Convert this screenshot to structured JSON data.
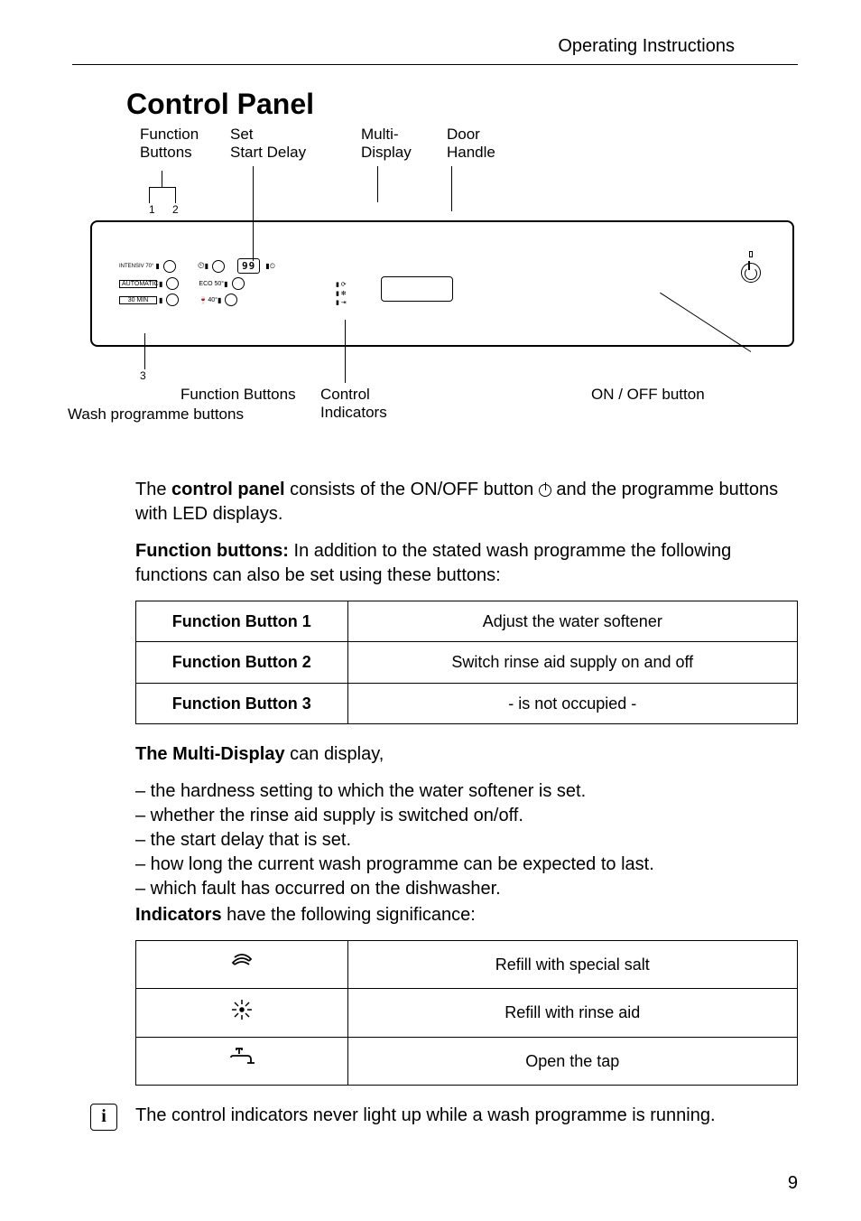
{
  "header": {
    "title": "Operating Instructions"
  },
  "heading": "Control Panel",
  "diagram": {
    "labels": {
      "function_buttons": "Function\nButtons",
      "set_start_delay": "Set\nStart Delay",
      "multi_display": "Multi-\nDisplay",
      "door_handle": "Door\nHandle",
      "num12": "1 2",
      "num3": "3",
      "function_buttons_b": "Function Buttons",
      "wash_prog": "Wash programme buttons",
      "control_indicators": "Control\nIndicators",
      "onoff": "ON / OFF button"
    },
    "panel": {
      "prog1": "INTENSIV 70°",
      "prog2": "AUTOMATIC",
      "prog3": "30 MIN",
      "col2_1": "ECO 50°",
      "col2_2": "40°",
      "display": "99"
    }
  },
  "body": {
    "p1_a": "The ",
    "p1_b": "control panel",
    "p1_c": " consists of the ON/OFF button ",
    "p1_d": " and the programme buttons with LED displays.",
    "p2_a": "Function buttons:",
    "p2_b": " In addition to the stated wash programme the following functions can also be set using these buttons:"
  },
  "func_table": [
    {
      "label": "Function Button 1",
      "desc": "Adjust the water softener"
    },
    {
      "label": "Function Button 2",
      "desc": "Switch rinse aid supply on and off"
    },
    {
      "label": "Function Button 3",
      "desc": "- is not occupied -"
    }
  ],
  "multi_display": {
    "heading": "The Multi-Display",
    "heading_after": " can display,",
    "items": [
      "– the hardness setting to which the water softener is set.",
      "– whether the rinse aid supply is switched on/off.",
      "– the start delay that is set.",
      "– how long the current wash programme can be expected to last.",
      "– which fault has occurred on the dishwasher."
    ]
  },
  "indicators": {
    "heading": "Indicators",
    "heading_after": " have the following significance:",
    "rows": [
      {
        "icon": "salt",
        "desc": "Refill with special salt"
      },
      {
        "icon": "rinse",
        "desc": "Refill with rinse aid"
      },
      {
        "icon": "tap",
        "desc": "Open the tap"
      }
    ]
  },
  "info_note": "The control indicators never light up while a wash programme is running.",
  "page_number": "9"
}
